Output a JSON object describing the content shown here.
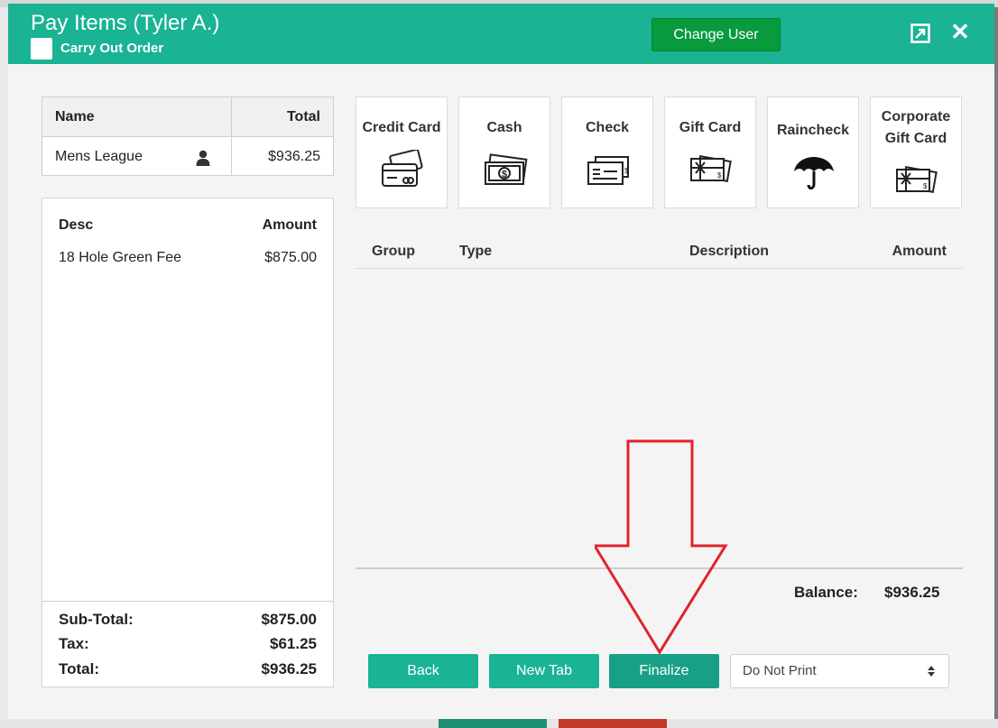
{
  "modal": {
    "title": "Pay Items (Tyler A.)",
    "carry_out_label": "Carry Out Order",
    "change_user_label": "Change User"
  },
  "customer_table": {
    "headers": {
      "name": "Name",
      "total": "Total"
    },
    "row": {
      "name": "Mens League",
      "total": "$936.25"
    }
  },
  "items": {
    "headers": {
      "desc": "Desc",
      "amount": "Amount"
    },
    "rows": [
      {
        "desc": "18 Hole Green Fee",
        "amount": "$875.00"
      }
    ],
    "totals": {
      "subtotal_label": "Sub-Total:",
      "subtotal": "$875.00",
      "tax_label": "Tax:",
      "tax": "$61.25",
      "total_label": "Total:",
      "total": "$936.25"
    }
  },
  "tenders": [
    {
      "label": "Credit Card",
      "icon": "credit-card-icon"
    },
    {
      "label": "Cash",
      "icon": "cash-icon"
    },
    {
      "label": "Check",
      "icon": "check-icon"
    },
    {
      "label": "Gift Card",
      "icon": "gift-card-icon"
    },
    {
      "label": "Raincheck",
      "icon": "umbrella-icon"
    },
    {
      "label": "Corporate Gift Card",
      "line1": "Corporate",
      "line2": "Gift Card",
      "icon": "gift-card-icon"
    }
  ],
  "payments": {
    "headers": {
      "group": "Group",
      "type": "Type",
      "description": "Description",
      "amount": "Amount"
    },
    "balance_label": "Balance:",
    "balance": "$936.25"
  },
  "actions": {
    "back": "Back",
    "new_tab": "New Tab",
    "finalize": "Finalize",
    "print_option": "Do Not Print"
  },
  "colors": {
    "header": "#1ab394",
    "change_user": "#079b3e",
    "annotation_arrow": "#e0232b"
  }
}
